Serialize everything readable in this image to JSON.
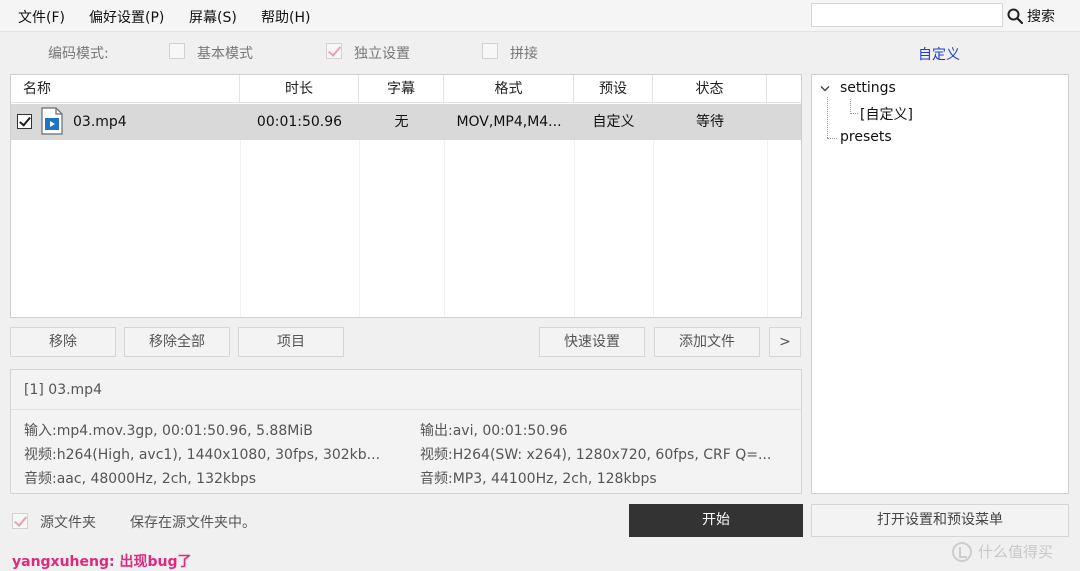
{
  "menu": {
    "file": "文件(F)",
    "preferences": "偏好设置(P)",
    "screen": "屏幕(S)",
    "help": "帮助(H)"
  },
  "search": {
    "value": "",
    "button_label": "搜索",
    "icon": "search-icon"
  },
  "mode": {
    "label": "编码模式:",
    "basic": {
      "label": "基本模式",
      "checked": false
    },
    "independent": {
      "label": "独立设置",
      "checked": true
    },
    "concat": {
      "label": "拼接",
      "checked": false
    },
    "custom_link": "自定义"
  },
  "table": {
    "columns": [
      "名称",
      "时长",
      "字幕",
      "格式",
      "预设",
      "状态"
    ],
    "rows": [
      {
        "checked": true,
        "icon": "video-file-icon",
        "name": "03.mp4",
        "duration": "00:01:50.96",
        "subtitle": "无",
        "format": "MOV,MP4,M4...",
        "preset": "自定义",
        "status": "等待"
      }
    ]
  },
  "buttons": {
    "remove": "移除",
    "remove_all": "移除全部",
    "item": "项目",
    "quick_settings": "快速设置",
    "add_file": "添加文件",
    "more": ">",
    "start": "开始",
    "open_settings": "打开设置和预设菜单"
  },
  "info": {
    "title": "[1] 03.mp4",
    "input": "输入:mp4.mov.3gp, 00:01:50.96, 5.88MiB",
    "in_video": "视频:h264(High, avc1), 1440x1080, 30fps, 302kb...",
    "in_audio": "音频:aac, 48000Hz, 2ch, 132kbps",
    "output": "输出:avi, 00:01:50.96",
    "out_video": "视频:H264(SW: x264), 1280x720, 60fps, CRF Q=...",
    "out_audio": "音频:MP3, 44100Hz, 2ch, 128kbps"
  },
  "tree": {
    "root": "settings",
    "child": "[自定义]",
    "sibling": "presets"
  },
  "bottom": {
    "source_folder": {
      "label": "源文件夹",
      "checked": true
    },
    "save_note": "保存在源文件夹中。"
  },
  "username": "yangxuheng: 出现bug了",
  "watermark": "什么值得买",
  "colors": {
    "accent_link": "#1f3ed1",
    "start_bg": "#333333",
    "selected_row": "#d9d9d9",
    "username": "#e0287e",
    "check_pink": "#e7a2b1"
  }
}
